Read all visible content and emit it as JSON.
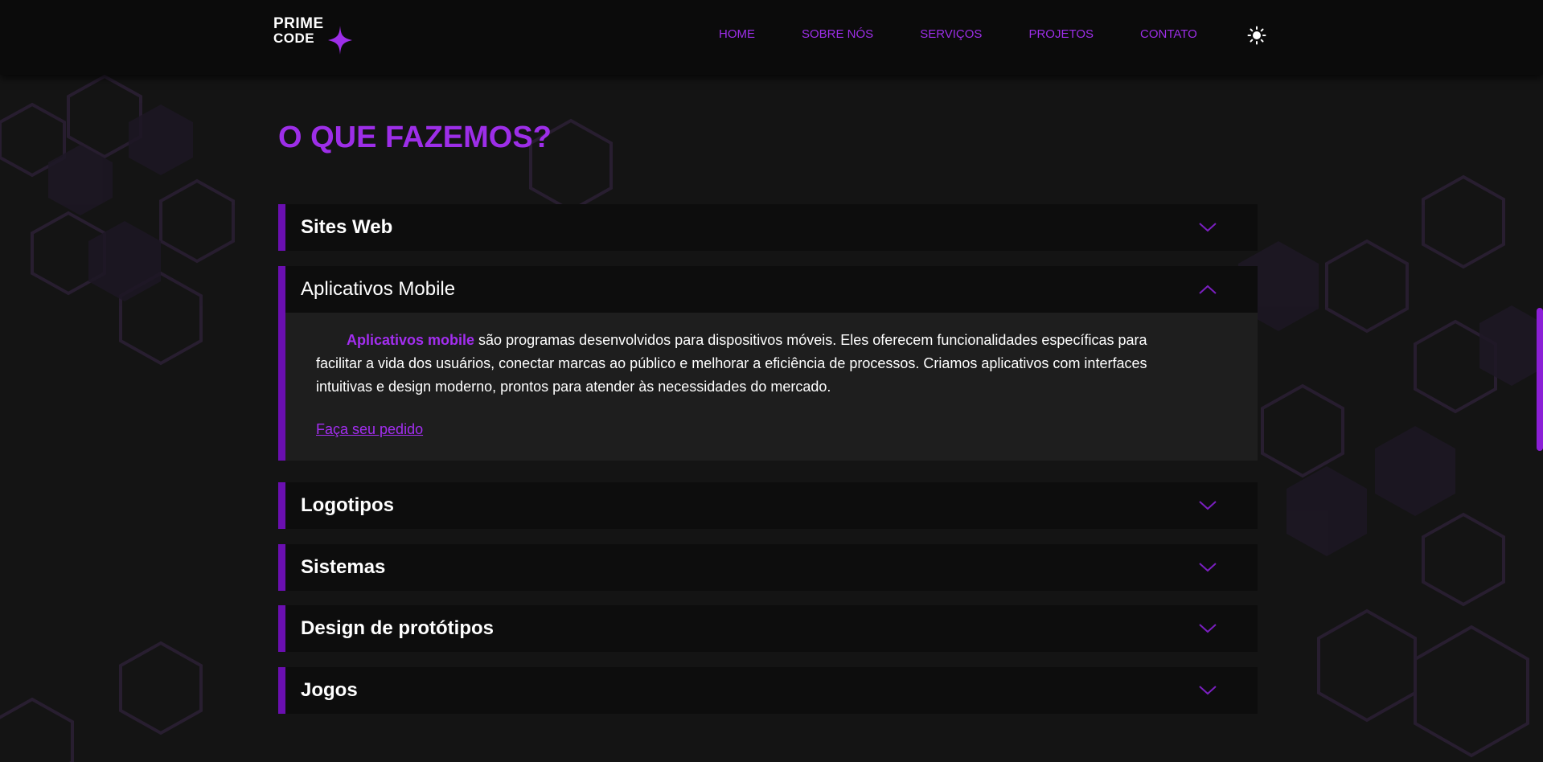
{
  "header": {
    "logo": {
      "line1": "PRIME",
      "line2": "CODE"
    },
    "nav": [
      {
        "label": "HOME"
      },
      {
        "label": "SOBRE NÓS"
      },
      {
        "label": "SERVIÇOS"
      },
      {
        "label": "PROJETOS"
      },
      {
        "label": "CONTATO"
      }
    ],
    "theme_toggle_icon": "sun-icon"
  },
  "main": {
    "title": "O QUE FAZEMOS?",
    "accordion": [
      {
        "title": "Sites Web",
        "expanded": false
      },
      {
        "title": "Aplicativos Mobile",
        "expanded": true,
        "highlight": "Aplicativos mobile",
        "text": " são programas desenvolvidos para dispositivos móveis. Eles oferecem funcionalidades específicas para facilitar a vida dos usuários, conectar marcas ao público e melhorar a eficiência de processos. Criamos aplicativos com interfaces intuitivas e design moderno, prontos para atender às necessidades do mercado.",
        "link": "Faça seu pedido"
      },
      {
        "title": "Logotipos",
        "expanded": false
      },
      {
        "title": "Sistemas",
        "expanded": false
      },
      {
        "title": "Design de protótipos",
        "expanded": false
      },
      {
        "title": "Jogos",
        "expanded": false
      }
    ]
  },
  "colors": {
    "accent": "#9d2ee8",
    "accent_dark": "#6a0fb0",
    "background": "#141414",
    "header": "#0b0b0b"
  }
}
